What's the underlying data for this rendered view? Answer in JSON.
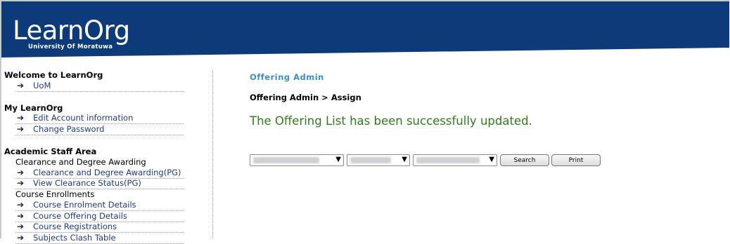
{
  "header": {
    "logo_text": "LearnOrg",
    "logo_subtitle": "University Of Moratuwa",
    "brand_color": "#0d3b7a"
  },
  "sidebar": {
    "welcome": {
      "title": "Welcome to LearnOrg",
      "items": [
        "UoM"
      ]
    },
    "my_learnorg": {
      "title": "My LearnOrg",
      "items": [
        "Edit Account information",
        "Change Password"
      ]
    },
    "academic": {
      "title": "Academic Staff Area",
      "groups": [
        {
          "label": "Clearance and Degree Awarding",
          "items": [
            "Clearance and Degree Awarding(PG)",
            "View Clearance Status(PG)"
          ]
        },
        {
          "label": "Course Enrollments",
          "items": [
            "Course Enrolment Details",
            "Course Offering Details",
            "Course Registrations",
            "Subjects Clash Table"
          ]
        }
      ]
    }
  },
  "main": {
    "section_title": "Offering Admin",
    "breadcrumb": "Offering Admin > Assign",
    "message": "The Offering List has been successfully updated.",
    "message_color": "#2e7d1a",
    "controls": {
      "search_label": "Search",
      "print_label": "Print"
    }
  }
}
